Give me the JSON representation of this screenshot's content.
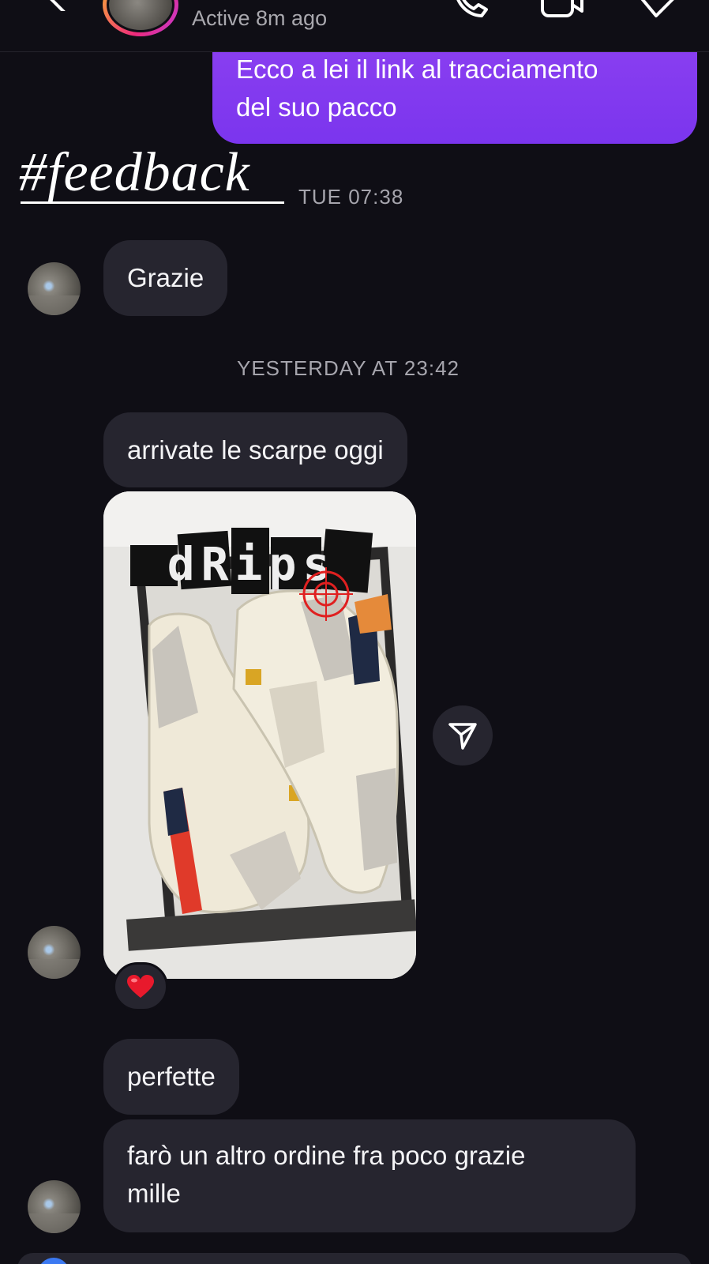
{
  "header": {
    "status": "Active 8m ago"
  },
  "messages": {
    "sent_1": "Ecco a lei il link al tracciamento\ndel suo pacco",
    "sticker_text": "#feedback",
    "time_1": "TUE 07:38",
    "recv_1": "Grazie",
    "time_2": "YESTERDAY AT 23:42",
    "recv_2": "arrivate le scarpe oggi",
    "photo_sticker": "dRips",
    "reaction": "❤️",
    "recv_3": "perfette",
    "recv_4": "farò un altro ordine fra poco grazie\nmille"
  },
  "colors": {
    "background": "#0f0e15",
    "sent_bubble": "#8a3ff0",
    "received_bubble": "#26252f",
    "timestamp": "#a6a5ad"
  },
  "icons": [
    "back-icon",
    "audio-call-icon",
    "video-call-icon",
    "tag-icon",
    "share-icon",
    "heart-icon"
  ]
}
